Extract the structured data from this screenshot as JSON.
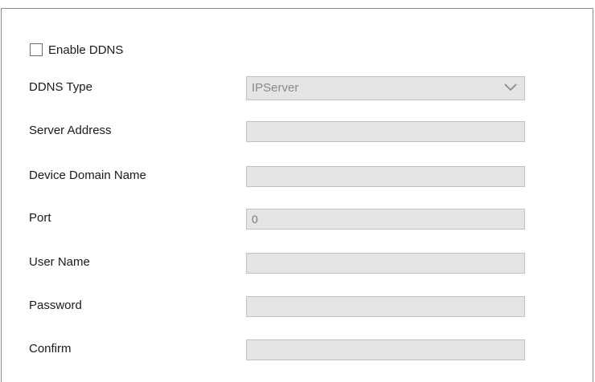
{
  "enable_ddns": {
    "label": "Enable DDNS",
    "checked": false
  },
  "fields": {
    "ddns_type": {
      "label": "DDNS Type",
      "value": "IPServer",
      "icon": "chevron-down-icon"
    },
    "server_address": {
      "label": "Server Address",
      "value": ""
    },
    "device_domain_name": {
      "label": "Device Domain Name",
      "value": ""
    },
    "port": {
      "label": "Port",
      "value": "0"
    },
    "user_name": {
      "label": "User Name",
      "value": ""
    },
    "password": {
      "label": "Password",
      "value": ""
    },
    "confirm": {
      "label": "Confirm",
      "value": ""
    }
  }
}
